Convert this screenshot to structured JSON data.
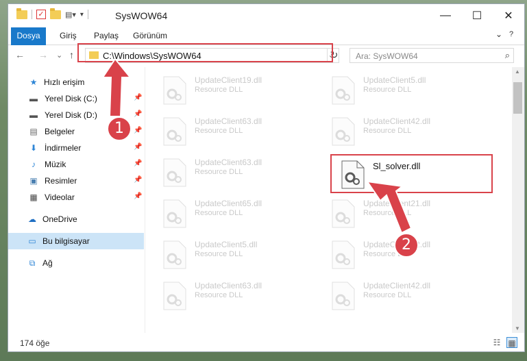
{
  "window": {
    "title": "SysWOW64",
    "controls": {
      "minimize": "—",
      "maximize": "☐",
      "close": "✕"
    }
  },
  "ribbon": {
    "tabs": [
      "Dosya",
      "Giriş",
      "Paylaş",
      "Görünüm"
    ],
    "expand_icon": "⌄",
    "help_icon": "?"
  },
  "nav": {
    "back": "←",
    "forward": "→",
    "recent": "⌄",
    "up": "↑",
    "address": "C:\\Windows\\SysWOW64",
    "address_drop": "⌄",
    "refresh": "↻",
    "search_placeholder": "Ara: SysWOW64",
    "search_icon": "⌕"
  },
  "sidebar": {
    "quick_access": "Hızlı erişim",
    "items": [
      {
        "label": "Yerel Disk (C:)",
        "icon": "drive-icon",
        "pinned": true
      },
      {
        "label": "Yerel Disk (D:)",
        "icon": "drive-icon",
        "pinned": true
      },
      {
        "label": "Belgeler",
        "icon": "documents-icon",
        "pinned": true
      },
      {
        "label": "İndirmeler",
        "icon": "downloads-icon",
        "pinned": true
      },
      {
        "label": "Müzik",
        "icon": "music-icon",
        "pinned": true
      },
      {
        "label": "Resimler",
        "icon": "pictures-icon",
        "pinned": true
      },
      {
        "label": "Videolar",
        "icon": "videos-icon",
        "pinned": true
      }
    ],
    "onedrive": "OneDrive",
    "this_pc": "Bu bilgisayar",
    "network": "Ağ"
  },
  "files": {
    "left": [
      {
        "name": "UpdateClient19.dll",
        "type": "Resource DLL"
      },
      {
        "name": "UpdateClient63.dll",
        "type": "Resource DLL"
      },
      {
        "name": "UpdateClient63.dll",
        "type": "Resource DLL"
      },
      {
        "name": "UpdateClient65.dll",
        "type": "Resource DLL"
      },
      {
        "name": "UpdateClient5.dll",
        "type": "Resource DLL"
      },
      {
        "name": "UpdateClient63.dll",
        "type": "Resource DLL"
      }
    ],
    "right": [
      {
        "name": "UpdateClient5.dll",
        "type": "Resource DLL"
      },
      {
        "name": "UpdateClient42.dll",
        "type": "Resource DLL"
      },
      {
        "name": "Sl_solver.dll",
        "type": "",
        "highlight": true
      },
      {
        "name": "UpdateClient21.dll",
        "type": "Resource DLL"
      },
      {
        "name": "UpdateClient42.dll",
        "type": "Resource DLL"
      },
      {
        "name": "UpdateClient42.dll",
        "type": "Resource DLL"
      }
    ]
  },
  "status": {
    "count": "174 öğe"
  },
  "annotations": {
    "step1": "1",
    "step2": "2",
    "color": "#d9424a"
  }
}
